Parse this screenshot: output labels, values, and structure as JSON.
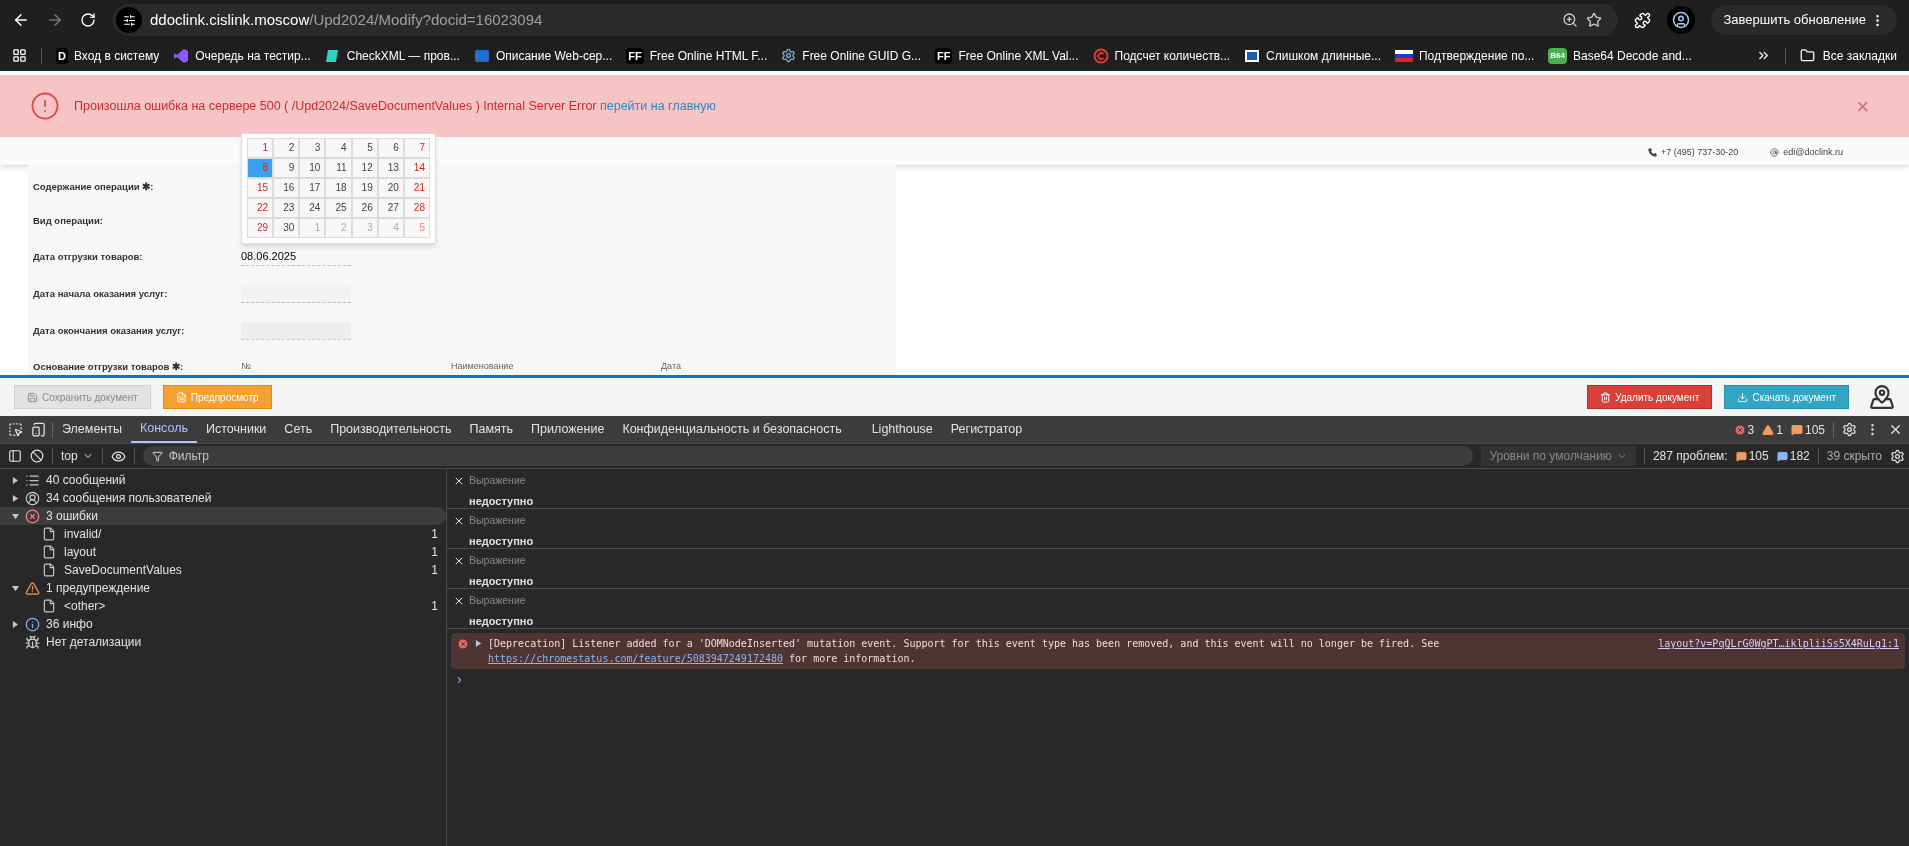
{
  "browser": {
    "url_host": "ddoclink.cislink.moscow",
    "url_path": "/Upd2024/Modify?docid=16023094",
    "update_button": "Завершить обновление",
    "bookmarks": [
      {
        "kind": "letter",
        "badge": "D",
        "label": "Вход в систему"
      },
      {
        "kind": "vs",
        "label": "Очередь на тестир..."
      },
      {
        "kind": "sheet",
        "label": "CheckXML — пров..."
      },
      {
        "kind": "share",
        "label": "Описание Web-сер..."
      },
      {
        "kind": "letter",
        "badge": "FF",
        "label": "Free Online HTML F..."
      },
      {
        "kind": "gear",
        "label": "Free Online GUID G..."
      },
      {
        "kind": "letter",
        "badge": "FF",
        "label": "Free Online XML Val..."
      },
      {
        "kind": "copyright",
        "label": "Подсчет количеств..."
      },
      {
        "kind": "window",
        "label": "Слишком длинные..."
      },
      {
        "kind": "flag",
        "label": "Подтверждение по..."
      },
      {
        "kind": "green",
        "badge": "B64",
        "label": "Base64 Decode and..."
      }
    ],
    "all_bookmarks": "Все закладки"
  },
  "banner": {
    "message": "Произошла ошибка на сервере 500 ( /Upd2024/SaveDocumentValues ) Internal Server Error",
    "link": "перейти на главную",
    "close": "×"
  },
  "header": {
    "phone": "+7 (495) 737-30-20",
    "email": "edi@doclink.ru"
  },
  "calendar": {
    "weeks": [
      [
        {
          "day": "1",
          "weekend": true,
          "other": false,
          "selected": false
        },
        {
          "day": "2",
          "weekend": false,
          "other": false,
          "selected": false
        },
        {
          "day": "3",
          "weekend": false,
          "other": false,
          "selected": false
        },
        {
          "day": "4",
          "weekend": false,
          "other": false,
          "selected": false
        },
        {
          "day": "5",
          "weekend": false,
          "other": false,
          "selected": false
        },
        {
          "day": "6",
          "weekend": false,
          "other": false,
          "selected": false
        },
        {
          "day": "7",
          "weekend": true,
          "other": false,
          "selected": false
        }
      ],
      [
        {
          "day": "8",
          "weekend": true,
          "other": false,
          "selected": true
        },
        {
          "day": "9",
          "weekend": false,
          "other": false,
          "selected": false
        },
        {
          "day": "10",
          "weekend": false,
          "other": false,
          "selected": false
        },
        {
          "day": "11",
          "weekend": false,
          "other": false,
          "selected": false
        },
        {
          "day": "12",
          "weekend": false,
          "other": false,
          "selected": false
        },
        {
          "day": "13",
          "weekend": false,
          "other": false,
          "selected": false
        },
        {
          "day": "14",
          "weekend": true,
          "other": false,
          "selected": false
        }
      ],
      [
        {
          "day": "15",
          "weekend": true,
          "other": false,
          "selected": false
        },
        {
          "day": "16",
          "weekend": false,
          "other": false,
          "selected": false
        },
        {
          "day": "17",
          "weekend": false,
          "other": false,
          "selected": false
        },
        {
          "day": "18",
          "weekend": false,
          "other": false,
          "selected": false
        },
        {
          "day": "19",
          "weekend": false,
          "other": false,
          "selected": false
        },
        {
          "day": "20",
          "weekend": false,
          "other": false,
          "selected": false
        },
        {
          "day": "21",
          "weekend": true,
          "other": false,
          "selected": false
        }
      ],
      [
        {
          "day": "22",
          "weekend": true,
          "other": false,
          "selected": false
        },
        {
          "day": "23",
          "weekend": false,
          "other": false,
          "selected": false
        },
        {
          "day": "24",
          "weekend": false,
          "other": false,
          "selected": false
        },
        {
          "day": "25",
          "weekend": false,
          "other": false,
          "selected": false
        },
        {
          "day": "26",
          "weekend": false,
          "other": false,
          "selected": false
        },
        {
          "day": "27",
          "weekend": false,
          "other": false,
          "selected": false
        },
        {
          "day": "28",
          "weekend": true,
          "other": false,
          "selected": false
        }
      ],
      [
        {
          "day": "29",
          "weekend": true,
          "other": false,
          "selected": false
        },
        {
          "day": "30",
          "weekend": false,
          "other": false,
          "selected": false
        },
        {
          "day": "1",
          "weekend": false,
          "other": true,
          "selected": false
        },
        {
          "day": "2",
          "weekend": false,
          "other": true,
          "selected": false
        },
        {
          "day": "3",
          "weekend": false,
          "other": true,
          "selected": false
        },
        {
          "day": "4",
          "weekend": false,
          "other": true,
          "selected": false
        },
        {
          "day": "5",
          "weekend": true,
          "other": true,
          "selected": false
        }
      ]
    ]
  },
  "form": {
    "fields": [
      {
        "kind": "hidden",
        "label": "Содержание операции ✱:"
      },
      {
        "kind": "hidden",
        "label": "Вид операции:"
      },
      {
        "kind": "input",
        "label": "Дата отгрузки товаров:",
        "value": "08.06.2025"
      },
      {
        "kind": "input",
        "label": "Дата начала оказания услуг:"
      },
      {
        "kind": "disabled",
        "label": "Дата окончания оказания услуг:"
      },
      {
        "kind": "table",
        "label": "Основание отгрузки товаров ✱:",
        "columns": [
          "№",
          "Наименование",
          "Дата"
        ]
      }
    ]
  },
  "toolbar": {
    "buttons": [
      {
        "kind": "save",
        "label": "Сохранить документ",
        "disabled": true
      },
      {
        "kind": "preview",
        "label": "Предпросмотр",
        "disabled": false
      },
      {
        "kind": "delete",
        "label": "Удалить документ",
        "disabled": false
      },
      {
        "kind": "download",
        "label": "Скачать документ",
        "disabled": false
      }
    ]
  },
  "devtools": {
    "tabs": [
      {
        "label": "Элементы",
        "selected": false
      },
      {
        "label": "Консоль",
        "selected": true
      },
      {
        "label": "Источники",
        "selected": false
      },
      {
        "label": "Сеть",
        "selected": false
      },
      {
        "label": "Производительность",
        "selected": false
      },
      {
        "label": "Память",
        "selected": false
      },
      {
        "label": "Приложение",
        "selected": false
      },
      {
        "label": "Конфиденциальность и безопасность",
        "selected": false
      },
      {
        "label": "Lighthouse",
        "selected": false
      },
      {
        "label": "Регистратор",
        "selected": false
      }
    ],
    "counts": {
      "errors": "3",
      "warnings": "1",
      "issues": "105"
    },
    "filter": {
      "context": "top",
      "placeholder": "Фильтр",
      "levels": "Уровни по умолчанию",
      "problems": "287 проблем:",
      "problems_orange": "105",
      "problems_blue": "182",
      "hidden": "39 скрыто"
    },
    "sidebar": [
      {
        "kind": "list",
        "label": "40 сообщений",
        "expanded": false,
        "selected": false
      },
      {
        "kind": "user",
        "label": "34 сообщения пользователей",
        "expanded": false,
        "selected": false
      },
      {
        "kind": "error",
        "label": "3 ошибки",
        "expanded": true,
        "selected": true,
        "children": [
          {
            "label": "invalid/",
            "count": "1"
          },
          {
            "label": "layout",
            "count": "1"
          },
          {
            "label": "SaveDocumentValues",
            "count": "1"
          }
        ]
      },
      {
        "kind": "warning",
        "label": "1 предупреждение",
        "expanded": true,
        "selected": false,
        "children": [
          {
            "label": "<other>",
            "count": "1"
          }
        ]
      },
      {
        "kind": "info",
        "label": "36 инфо",
        "expanded": false,
        "selected": false
      },
      {
        "kind": "verbose",
        "label": "Нет детализации"
      }
    ],
    "expressions": [
      {
        "label": "Выражение",
        "value": "недоступно"
      },
      {
        "label": "Выражение",
        "value": "недоступно"
      },
      {
        "label": "Выражение",
        "value": "недоступно"
      },
      {
        "label": "Выражение",
        "value": "недоступно"
      }
    ],
    "message": {
      "text": "[Deprecation] Listener added for a 'DOMNodeInserted' mutation event. Support for this event type has been removed, and this event will no longer be fired. See",
      "link": "https://chromestatus.com/feature/5083947249172480",
      "tail": "for more information.",
      "source": "layout?v=PqQLrG0WgPT…iklpliiSs5X4RuLg1:1"
    },
    "prompt": "›"
  }
}
